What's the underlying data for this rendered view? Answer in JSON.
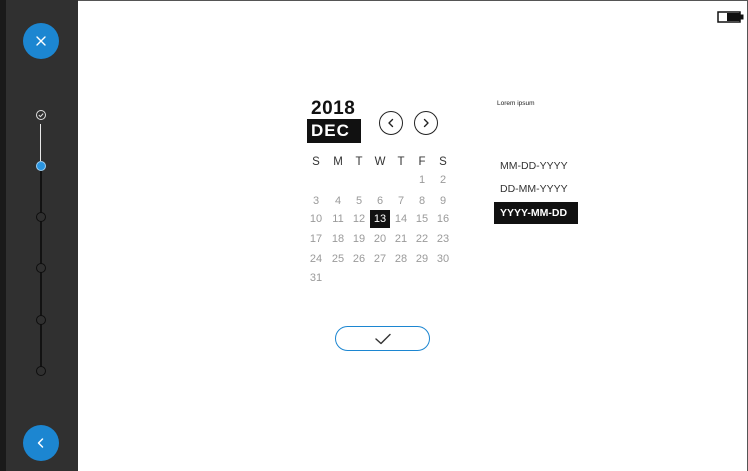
{
  "icons": {
    "close": "close-icon",
    "back": "chevron-left-icon",
    "battery": "battery-icon",
    "prev": "chevron-left-icon",
    "next": "chevron-right-icon",
    "confirm": "checkmark-icon",
    "step_done": "check-circle-icon"
  },
  "colors": {
    "accent": "#1c86d1",
    "sidebar": "#303030",
    "selected_bg": "#111111"
  },
  "stepper": {
    "steps": [
      "done",
      "current",
      "todo",
      "todo",
      "todo",
      "todo"
    ]
  },
  "calendar": {
    "year": "2018",
    "month": "DEC",
    "weekdays": [
      "S",
      "M",
      "T",
      "W",
      "T",
      "F",
      "S"
    ],
    "weeks": [
      [
        "",
        "",
        "",
        "",
        "",
        "1",
        "2"
      ],
      [
        "3",
        "4",
        "5",
        "6",
        "7",
        "8",
        "9"
      ],
      [
        "10",
        "11",
        "12",
        "13",
        "14",
        "15",
        "16"
      ],
      [
        "17",
        "18",
        "19",
        "20",
        "21",
        "22",
        "23"
      ],
      [
        "24",
        "25",
        "26",
        "27",
        "28",
        "29",
        "30"
      ],
      [
        "31",
        "",
        "",
        "",
        "",
        "",
        ""
      ]
    ],
    "selected_day": "13"
  },
  "format_panel": {
    "label": "Lorem ipsum",
    "options": [
      "MM-DD-YYYY",
      "DD-MM-YYYY",
      "YYYY-MM-DD"
    ],
    "selected": "YYYY-MM-DD"
  }
}
